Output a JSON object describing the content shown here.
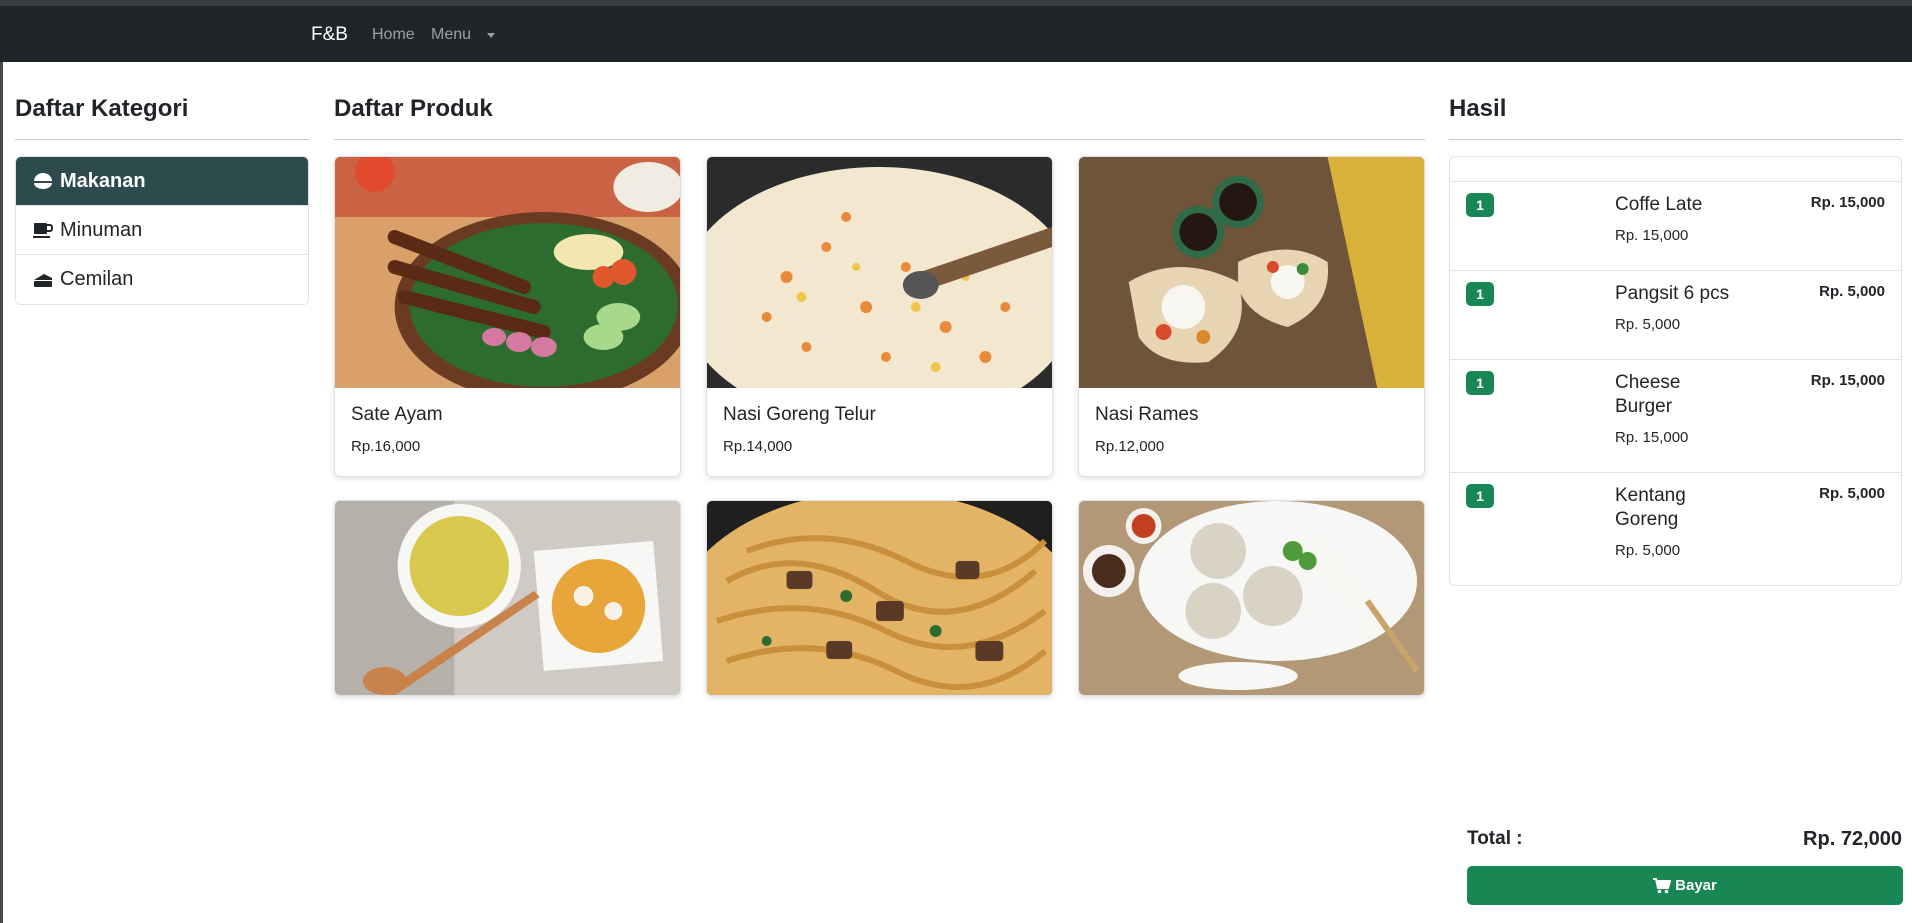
{
  "navbar": {
    "brand": "F&B",
    "home": "Home",
    "menu": "Menu"
  },
  "categories": {
    "title": "Daftar Kategori",
    "items": [
      {
        "label": "Makanan",
        "icon": "bowl-icon",
        "active": true
      },
      {
        "label": "Minuman",
        "icon": "mug-icon",
        "active": false
      },
      {
        "label": "Cemilan",
        "icon": "cake-icon",
        "active": false
      }
    ]
  },
  "products": {
    "title": "Daftar Produk",
    "items": [
      {
        "name": "Sate Ayam",
        "price": "Rp.16,000"
      },
      {
        "name": "Nasi Goreng Telur",
        "price": "Rp.14,000"
      },
      {
        "name": "Nasi Rames",
        "price": "Rp.12,000"
      }
    ]
  },
  "result": {
    "title": "Hasil",
    "items": [
      {
        "qty": "1",
        "name": "Coffe Late",
        "price": "Rp. 15,000",
        "total": "Rp. 15,000"
      },
      {
        "qty": "1",
        "name": "Pangsit 6 pcs",
        "price": "Rp. 5,000",
        "total": "Rp. 5,000"
      },
      {
        "qty": "1",
        "name": "Cheese Burger",
        "price": "Rp. 15,000",
        "total": "Rp. 15,000"
      },
      {
        "qty": "1",
        "name": "Kentang Goreng",
        "price": "Rp. 5,000",
        "total": "Rp. 5,000"
      }
    ],
    "total_label": "Total :",
    "total_value": "Rp. 72,000",
    "pay_label": "Bayar"
  },
  "colors": {
    "navbar": "#212529",
    "active_category": "#2d4b4c",
    "accent": "#198754"
  }
}
